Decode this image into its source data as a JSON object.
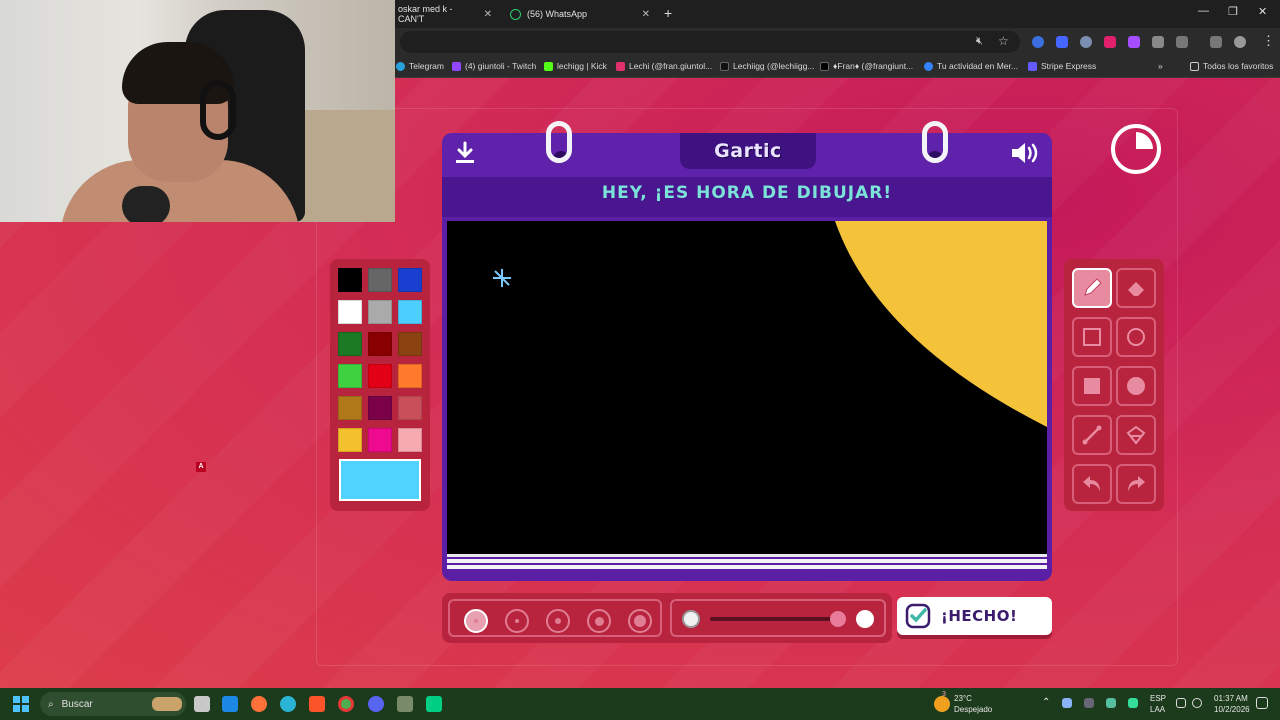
{
  "browser": {
    "tabs": [
      {
        "label": "oskar med k - CAN'T"
      },
      {
        "label": "(56) WhatsApp"
      }
    ],
    "bookmarks": [
      {
        "label": "Telegram",
        "color": "#2aa1da"
      },
      {
        "label": "(4) giuntoli - Twitch",
        "color": "#9146ff"
      },
      {
        "label": "lechigg | Kick",
        "color": "#53fc18"
      },
      {
        "label": "Lechi (@fran.giuntol...",
        "color": "#e1306c"
      },
      {
        "label": "Lechiigg (@lechiigg...",
        "color": "#111111"
      },
      {
        "label": "♦Fran♦ (@frangiunt...",
        "color": "#000000"
      },
      {
        "label": "Tu actividad en Mer...",
        "color": "#3483fa"
      },
      {
        "label": "Stripe Express",
        "color": "#635bff"
      }
    ],
    "all_bookmarks": "Todos los favoritos"
  },
  "game": {
    "logo": "Gartic",
    "headline": "HEY, ¡ES HORA DE DIBUJAR!",
    "done_label": "¡HECHO!",
    "palette": [
      "#000000",
      "#666666",
      "#1a3fd0",
      "#ffffff",
      "#aaaaaa",
      "#4dd0ff",
      "#1d7a24",
      "#8a0000",
      "#8a4210",
      "#3fd13f",
      "#e10015",
      "#ff7a2a",
      "#b07818",
      "#7a0048",
      "#c9505b",
      "#f4c12c",
      "#ee0a8e",
      "#f7aab0"
    ],
    "selected_color": "#50d4ff",
    "tools": [
      "pencil-icon",
      "eraser-icon",
      "rectangle-outline-icon",
      "circle-outline-icon",
      "rectangle-filled-icon",
      "circle-filled-icon",
      "line-icon",
      "fill-bucket-icon",
      "undo-icon",
      "redo-icon"
    ],
    "active_tool": "pencil-icon",
    "brush_sizes": 5,
    "selected_size_index": 0,
    "timer_remaining_fraction": 0.75
  },
  "taskbar": {
    "search": "Buscar",
    "weather_temp": "23°C",
    "weather_desc": "Despejado",
    "weather_badge": "3",
    "lang": "ESP",
    "lang2": "LAA",
    "time": "01:37 AM",
    "date": "10/2/2026"
  },
  "stream_marker": "A"
}
